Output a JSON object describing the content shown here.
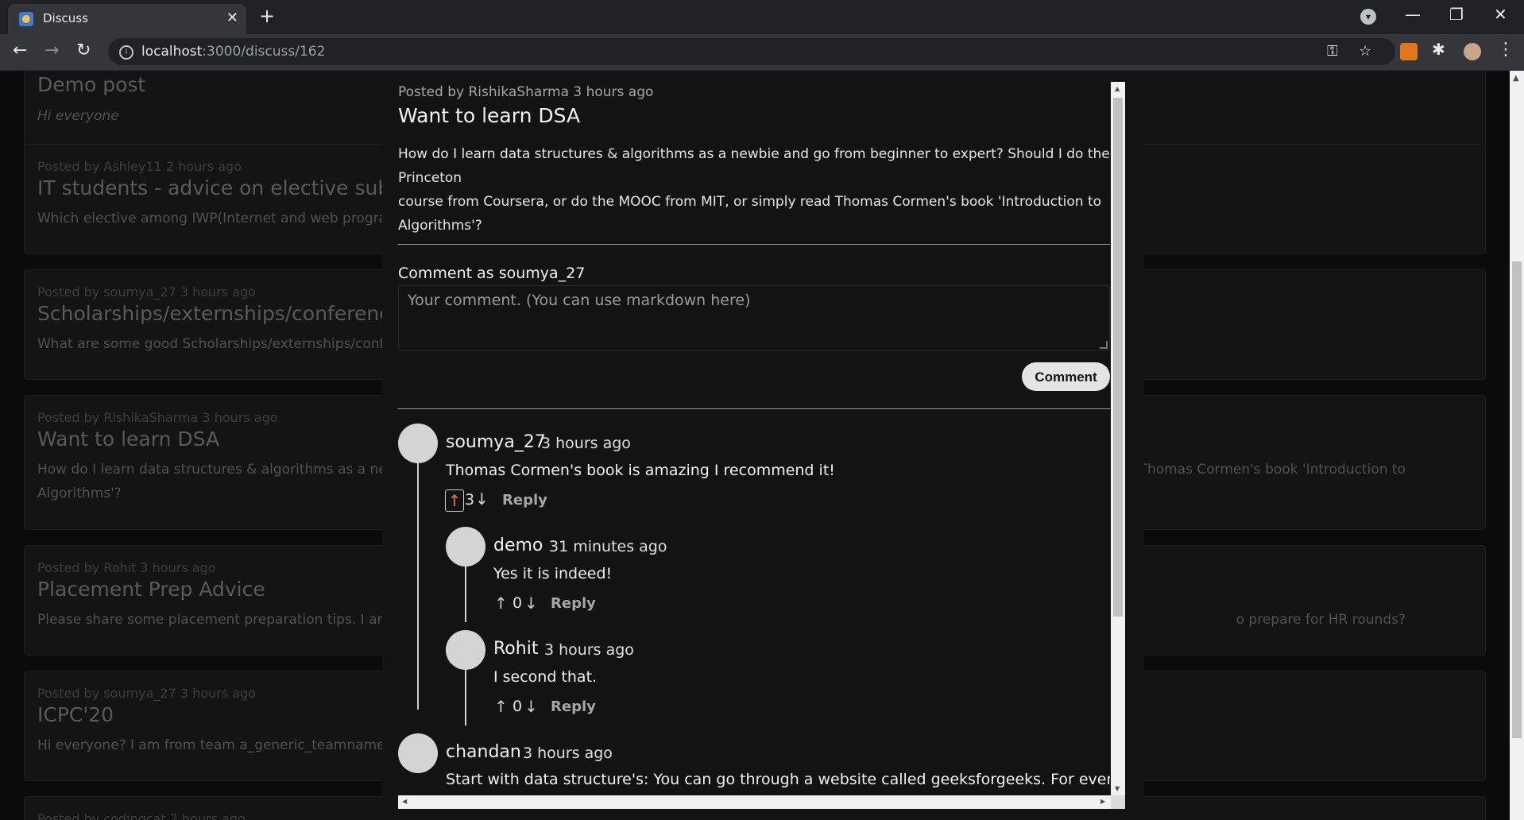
{
  "browser": {
    "tab_title": "Discuss",
    "tab_close": "✕",
    "new_tab": "+",
    "url_host": "localhost",
    "url_path": ":3000/discuss/162",
    "back": "←",
    "forward": "→",
    "reload": "↻",
    "window_controls": {
      "minimize": "—",
      "restore": "❐",
      "close": "✕"
    },
    "key_icon": "⚿",
    "star_icon": "☆",
    "puzzle_icon": "✱",
    "menu_icon": "⋮",
    "tab_search_icon": "▾"
  },
  "background_posts": [
    {
      "meta": "",
      "title": "Demo post",
      "text": "Hi everyone",
      "text_right": ""
    },
    {
      "meta": "Posted by Ashley11 2 hours ago",
      "title": "IT students - advice on elective subjects",
      "text": "Which elective among IWP(Internet and web programmi",
      "text_right": ""
    },
    {
      "meta": "Posted by soumya_27 3 hours ago",
      "title": "Scholarships/externships/conferences",
      "text": "What are some good Scholarships/externships/conferen",
      "text_right": ""
    },
    {
      "meta": "Posted by RishikaSharma 3 hours ago",
      "title": "Want to learn DSA",
      "text": "How do I learn data structures & algorithms as a newbie",
      "text2": "Algorithms'?",
      "text_right": "Thomas Cormen's book 'Introduction to"
    },
    {
      "meta": "Posted by Rohit 3 hours ago",
      "title": "Placement Prep Advice",
      "text": "Please share some placement preparation tips. I am a thi",
      "text_right": "o prepare for HR rounds?"
    },
    {
      "meta": "Posted by soumya_27 3 hours ago",
      "title": "ICPC'20",
      "text": "Hi everyone? I am from team a_generic_teamname. How",
      "text_right": ""
    },
    {
      "meta": "Posted by codingcat 2 hours ago",
      "title": "",
      "text": "",
      "text_right": ""
    }
  ],
  "post": {
    "meta": "Posted by RishikaSharma 3 hours ago",
    "title": "Want to learn DSA",
    "body_line1": "How do I learn data structures & algorithms as a newbie and go from beginner to expert? Should I do the Princeton",
    "body_line2": "course from Coursera, or do the MOOC from MIT, or simply read Thomas Cormen's book 'Introduction to",
    "body_line3": "Algorithms'?"
  },
  "comment_form": {
    "label": "Comment as soumya_27",
    "placeholder": "Your comment. (You can use markdown here)",
    "submit_label": "Comment"
  },
  "comments": [
    {
      "author": "soumya_27",
      "time": "3 hours ago",
      "text": "Thomas Cormen's book is amazing I recommend it!",
      "votes": "3",
      "reply": "Reply",
      "replies": [
        {
          "author": "demo",
          "time": "31 minutes ago",
          "text": "Yes it is indeed!",
          "votes": "0",
          "reply": "Reply"
        },
        {
          "author": "Rohit",
          "time": "3 hours ago",
          "text": "I second that.",
          "votes": "0",
          "reply": "Reply"
        }
      ]
    },
    {
      "author": "chandan",
      "time": "3 hours ago",
      "text": "Start with data structure's: You can go through a website called geeksforgeeks. For every",
      "votes": "",
      "reply": "Reply",
      "replies": []
    }
  ],
  "icons": {
    "upvote": "↑",
    "downvote": "↓",
    "scroll_up": "▲",
    "scroll_down": "▼",
    "scroll_left": "◀",
    "scroll_right": "▶"
  },
  "colors": {
    "upvote_active": "#f0742c",
    "page_background": "#0b0b0b",
    "modal_background": "#131313"
  }
}
